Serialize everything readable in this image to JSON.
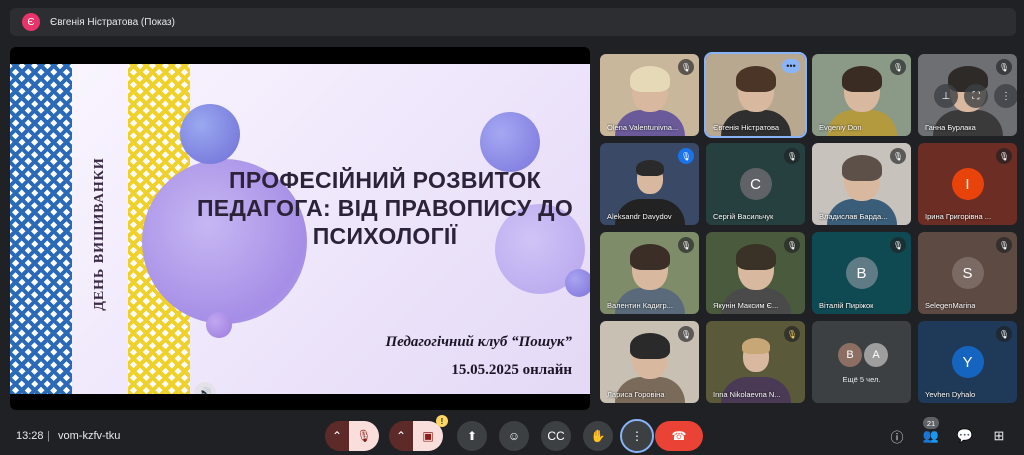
{
  "presenter": {
    "avatar_letter": "Є",
    "label": "Євгенія Ністратова (Показ)",
    "avatar_color": "#e8336b"
  },
  "slide": {
    "vertical_text": "ДЕНЬ ВИШИВАНКИ",
    "title": "ПРОФЕСІЙНИЙ РОЗВИТОК ПЕДАГОГА: ВІД ПРАВОПИСУ ДО ПСИХОЛОГІЇ",
    "club": "Педагогічний клуб “Пошук”",
    "date": "15.05.2025 онлайн",
    "speaker_icon": "speaker-icon"
  },
  "participants": [
    {
      "name": "Olena Valentunivna...",
      "kind": "photo",
      "mic": "muted"
    },
    {
      "name": "Євгенія Ністратова",
      "kind": "photo",
      "mic": "more",
      "self": true
    },
    {
      "name": "Evgeniy Don",
      "kind": "photo",
      "mic": "muted"
    },
    {
      "name": "Ганна Бурлака",
      "kind": "photo",
      "mic": "muted"
    },
    {
      "name": "Aleksandr Davydov",
      "kind": "photo",
      "mic": "muted-blue"
    },
    {
      "name": "Сергій Васильчук",
      "kind": "initial",
      "initial": "С",
      "color": "#5f6368",
      "mic": "muted"
    },
    {
      "name": "Владислав Барда...",
      "kind": "photo",
      "mic": "muted"
    },
    {
      "name": "Ірина Григорівна ...",
      "kind": "initial",
      "initial": "І",
      "color": "#e8430a",
      "mic": "muted"
    },
    {
      "name": "Валентин Кадигр...",
      "kind": "photo",
      "mic": "muted"
    },
    {
      "name": "Якунін Максим Є...",
      "kind": "photo",
      "mic": "muted"
    },
    {
      "name": "Віталій Пиріжок",
      "kind": "initial",
      "initial": "В",
      "color": "#5f7b85",
      "mic": "muted"
    },
    {
      "name": "SelegenMarina",
      "kind": "initial",
      "initial": "S",
      "color": "#7b6a63",
      "mic": "muted"
    },
    {
      "name": "Лариса Горовіна",
      "kind": "photo",
      "mic": "muted"
    },
    {
      "name": "Inna Nikolaevna N...",
      "kind": "photo",
      "mic": "muted-yellow"
    },
    {
      "name": "Ещё 5 чел.",
      "kind": "more",
      "initials": [
        "B",
        "A"
      ]
    },
    {
      "name": "Yevhen Dyhalo",
      "kind": "initial",
      "initial": "Y",
      "color": "#1565c0",
      "mic": "muted"
    }
  ],
  "bottom": {
    "time": "13:28",
    "separator": "|",
    "meeting_code": "vom-kzfv-tku",
    "participant_count": "21"
  },
  "colors": {
    "background": "#202124",
    "end_call": "#ea4335",
    "accent": "#8ab4f8"
  }
}
